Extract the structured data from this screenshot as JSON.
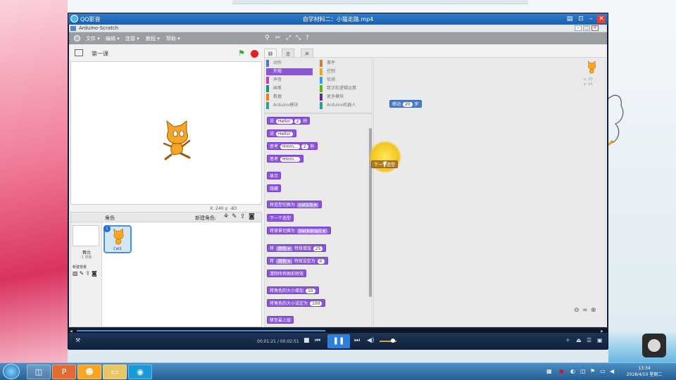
{
  "player": {
    "app_name": "QQ影音",
    "video_title": "自学材料二：小猫走路.mp4",
    "time": "00:01:21 / 00:02:51",
    "progress": 0.47,
    "volume": 0.8
  },
  "scratch": {
    "window_title": "Arduino-Scratch",
    "menus": [
      "文件",
      "编辑",
      "连接",
      "教程",
      "帮助"
    ],
    "project_title": "第一课",
    "stage_coords": "X: 240  y: -83",
    "sprites_label": "角色",
    "new_sprite_label": "新建角色:",
    "stage_label": "舞台",
    "stage_backdrops": "1 背景",
    "new_backdrop_label": "新建背景",
    "sprite_name": "Cat1",
    "tabs": [
      "脚本",
      "造型",
      "声音"
    ],
    "categories_left": [
      "动作",
      "外观",
      "声音",
      "画笔",
      "数据",
      "Arduino模块"
    ],
    "categories_right": [
      "事件",
      "控制",
      "侦测",
      "数字和逻辑运算",
      "更多模块",
      "Arduino机器人"
    ],
    "active_category": "外观",
    "blocks": {
      "say_for": {
        "pre": "说",
        "msg": "Hello!",
        "num": "2",
        "post": "秒"
      },
      "say": {
        "pre": "说",
        "msg": "Hello!"
      },
      "think_for": {
        "pre": "思考",
        "msg": "Hmm...",
        "num": "2",
        "post": "秒"
      },
      "think": {
        "pre": "思考",
        "msg": "Hmm..."
      },
      "show": "显示",
      "hide": "隐藏",
      "switch_costume": {
        "pre": "将造型切换为",
        "val": "cat1-b"
      },
      "next_costume": "下一个造型",
      "switch_backdrop": {
        "pre": "将背景切换为",
        "val": "backdrop1"
      },
      "change_effect": {
        "pre": "将",
        "effect": "颜色",
        "mid": "特效增加",
        "num": "25"
      },
      "set_effect": {
        "pre": "将",
        "effect": "颜色",
        "mid": "特效设定为",
        "num": "0"
      },
      "clear_effects": "清除所有图形特效",
      "change_size": {
        "pre": "将角色的大小增加",
        "num": "10"
      },
      "set_size": {
        "pre": "将角色的大小设定为",
        "num": "100"
      },
      "front": "移至最上层"
    },
    "script_move": {
      "pre": "移动",
      "num": "20",
      "post": "步"
    },
    "dragged_block": "下一个造型",
    "sprite_info": {
      "x": "x: 33",
      "y": "y: 14"
    },
    "zoom": [
      "⊖",
      "=",
      "⊕"
    ]
  },
  "taskbar": {
    "time": "13:34",
    "date": "2018/4/10 星期二"
  },
  "colors": {
    "looks": "#8a55d7",
    "motion": "#4c79c8",
    "control": "#b27a1c",
    "accent": "#2e7fdb"
  }
}
